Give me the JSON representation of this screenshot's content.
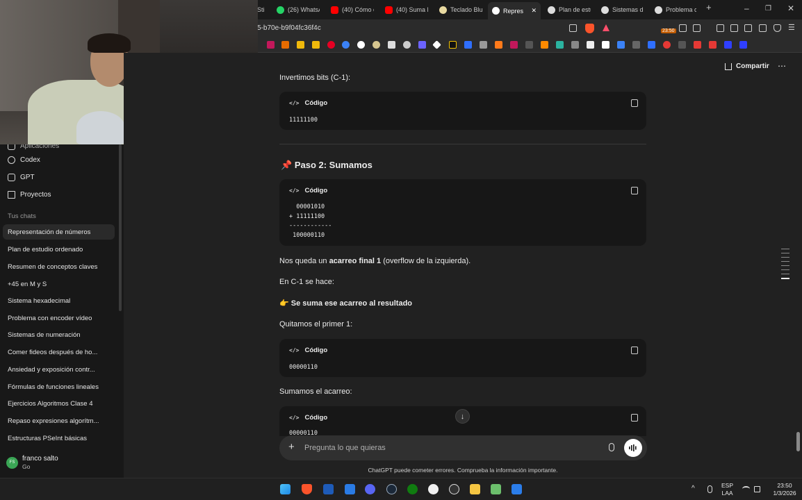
{
  "browser": {
    "tabs": [
      {
        "label": "Sti",
        "color": "#777"
      },
      {
        "label": "(26) WhatsA",
        "color": "#25d366"
      },
      {
        "label": "(40) Cómo c",
        "color": "#ff0000"
      },
      {
        "label": "(40) Suma B",
        "color": "#ff0000"
      },
      {
        "label": "Teclado Blue",
        "color": "#e8d9a0"
      },
      {
        "label": "Repres",
        "color": "#ffffff"
      },
      {
        "label": "Plan de estu",
        "color": "#ffffff"
      },
      {
        "label": "Sistemas de",
        "color": "#ffffff"
      },
      {
        "label": "Problema c",
        "color": "#ffffff"
      }
    ],
    "tab_close": "✕",
    "new_tab": "+",
    "url": "5-b70e-b9f04fc36f4c",
    "clock_badge": "23:50",
    "window_controls": {
      "minimize": "–",
      "maximize": "❐",
      "close": "✕"
    }
  },
  "sidebar": {
    "partial_item": "Aplicaciones",
    "nav": [
      {
        "label": "Codex",
        "icon": "cloud-icon"
      },
      {
        "label": "GPT",
        "icon": "cube-icon"
      },
      {
        "label": "Proyectos",
        "icon": "folder-icon"
      }
    ],
    "section_title": "Tus chats",
    "chats": [
      "Representación de números",
      "Plan de estudio ordenado",
      "Resumen de conceptos claves",
      "+45 en M y S",
      "Sistema hexadecimal",
      "Problema con encoder vídeo",
      "Sistemas de numeración",
      "Comer fideos después de ho...",
      "Ansiedad y exposición contr...",
      "Fórmulas de funciones lineales",
      "Ejercicios Algoritmos Clase 4",
      "Repaso expresiones algorítm...",
      "Estructuras PSeInt básicas"
    ],
    "user": {
      "initials": "FS",
      "name": "franco salto",
      "plan": "Go"
    }
  },
  "main": {
    "share_label": "Compartir",
    "more": "⋯",
    "p_invert": "Invertimos bits (C-1):",
    "code_label": "Código",
    "code_icon": "</>",
    "code1": "11111100",
    "heading_emoji": "📌",
    "heading": "Paso 2: Sumamos",
    "code2": "  00001010\n+ 11111100\n------------\n 100000110",
    "p_carry_pre": "Nos queda un ",
    "p_carry_bold": "acarreo final 1",
    "p_carry_post": " (overflow de la izquierda).",
    "p_c1": "En C-1 se hace:",
    "p_point_emoji": "👉",
    "p_point_bold": "Se suma ese acarreo al resultado",
    "p_remove": "Quitamos el primer 1:",
    "code3": "00000110",
    "p_add": "Sumamos el acarreo:",
    "code4": "00000110",
    "scroll_down": "↓",
    "composer_plus": "+",
    "composer_placeholder": "Pregunta lo que quieras",
    "disclaimer": "ChatGPT puede cometer errores. Comprueba la información importante."
  },
  "taskbar": {
    "lang": "ESP",
    "layout": "LAA",
    "time": "23:50",
    "date": "1/3/2026",
    "tray_up": "^"
  }
}
